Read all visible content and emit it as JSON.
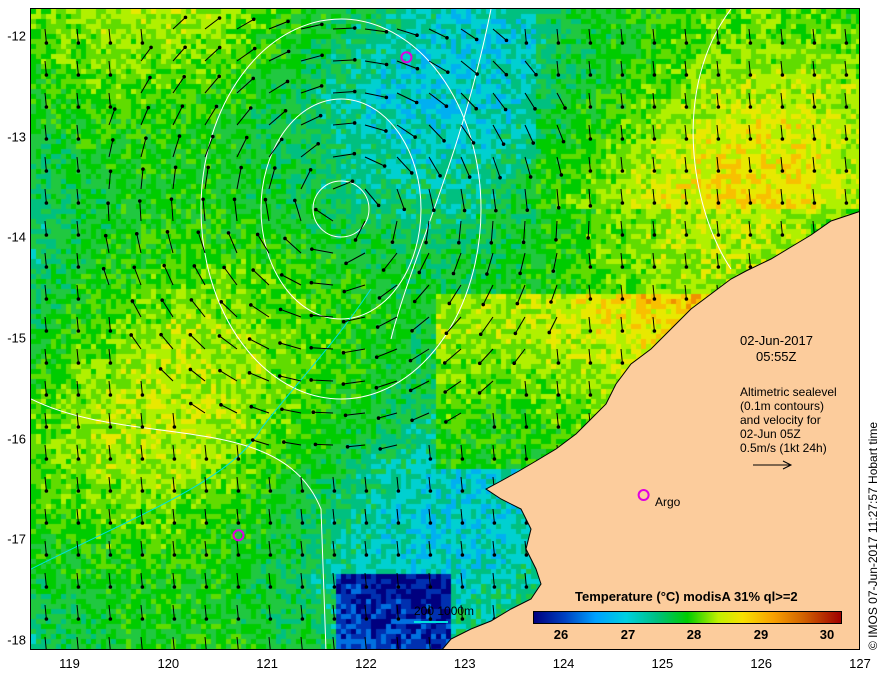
{
  "map": {
    "x_ticks": [
      "119",
      "120",
      "121",
      "122",
      "123",
      "124",
      "125",
      "126",
      "127"
    ],
    "x_tick_values": [
      119,
      120,
      121,
      122,
      123,
      124,
      125,
      126,
      127
    ],
    "y_ticks": [
      "-12",
      "-13",
      "-14",
      "-15",
      "-16",
      "-17",
      "-18"
    ],
    "y_tick_values": [
      -12,
      -13,
      -14,
      -15,
      -16,
      -17,
      -18
    ],
    "lon_range": [
      118.6,
      127.0
    ],
    "lat_range": [
      -18.1,
      -11.72
    ]
  },
  "date": "02-Jun-2017",
  "time": "05:55Z",
  "legend_text": [
    "Altimetric sealevel",
    "(0.1m contours)",
    "and velocity for",
    "02-Jun 05Z",
    "0.5m/s (1kt 24h)"
  ],
  "argo_label": "Argo",
  "argo_floats": [
    {
      "lon": 122.4,
      "lat": -12.2
    },
    {
      "lon": 124.8,
      "lat": -16.55
    },
    {
      "lon": 120.7,
      "lat": -16.95
    }
  ],
  "colorbar": {
    "title": "Temperature (°C) modisA 31% ql>=2",
    "ticks": [
      "26",
      "27",
      "28",
      "29",
      "30"
    ],
    "range": [
      25.6,
      30.2
    ]
  },
  "depth_scale_label": "200  1000m",
  "credit": "© IMOS 07-Jun-2017 11:27:57 Hobart time",
  "colors": {
    "land": "#fccc9c",
    "contour": "#ffffff",
    "isobath": "#00e0e0",
    "argo": "#e000e0"
  }
}
